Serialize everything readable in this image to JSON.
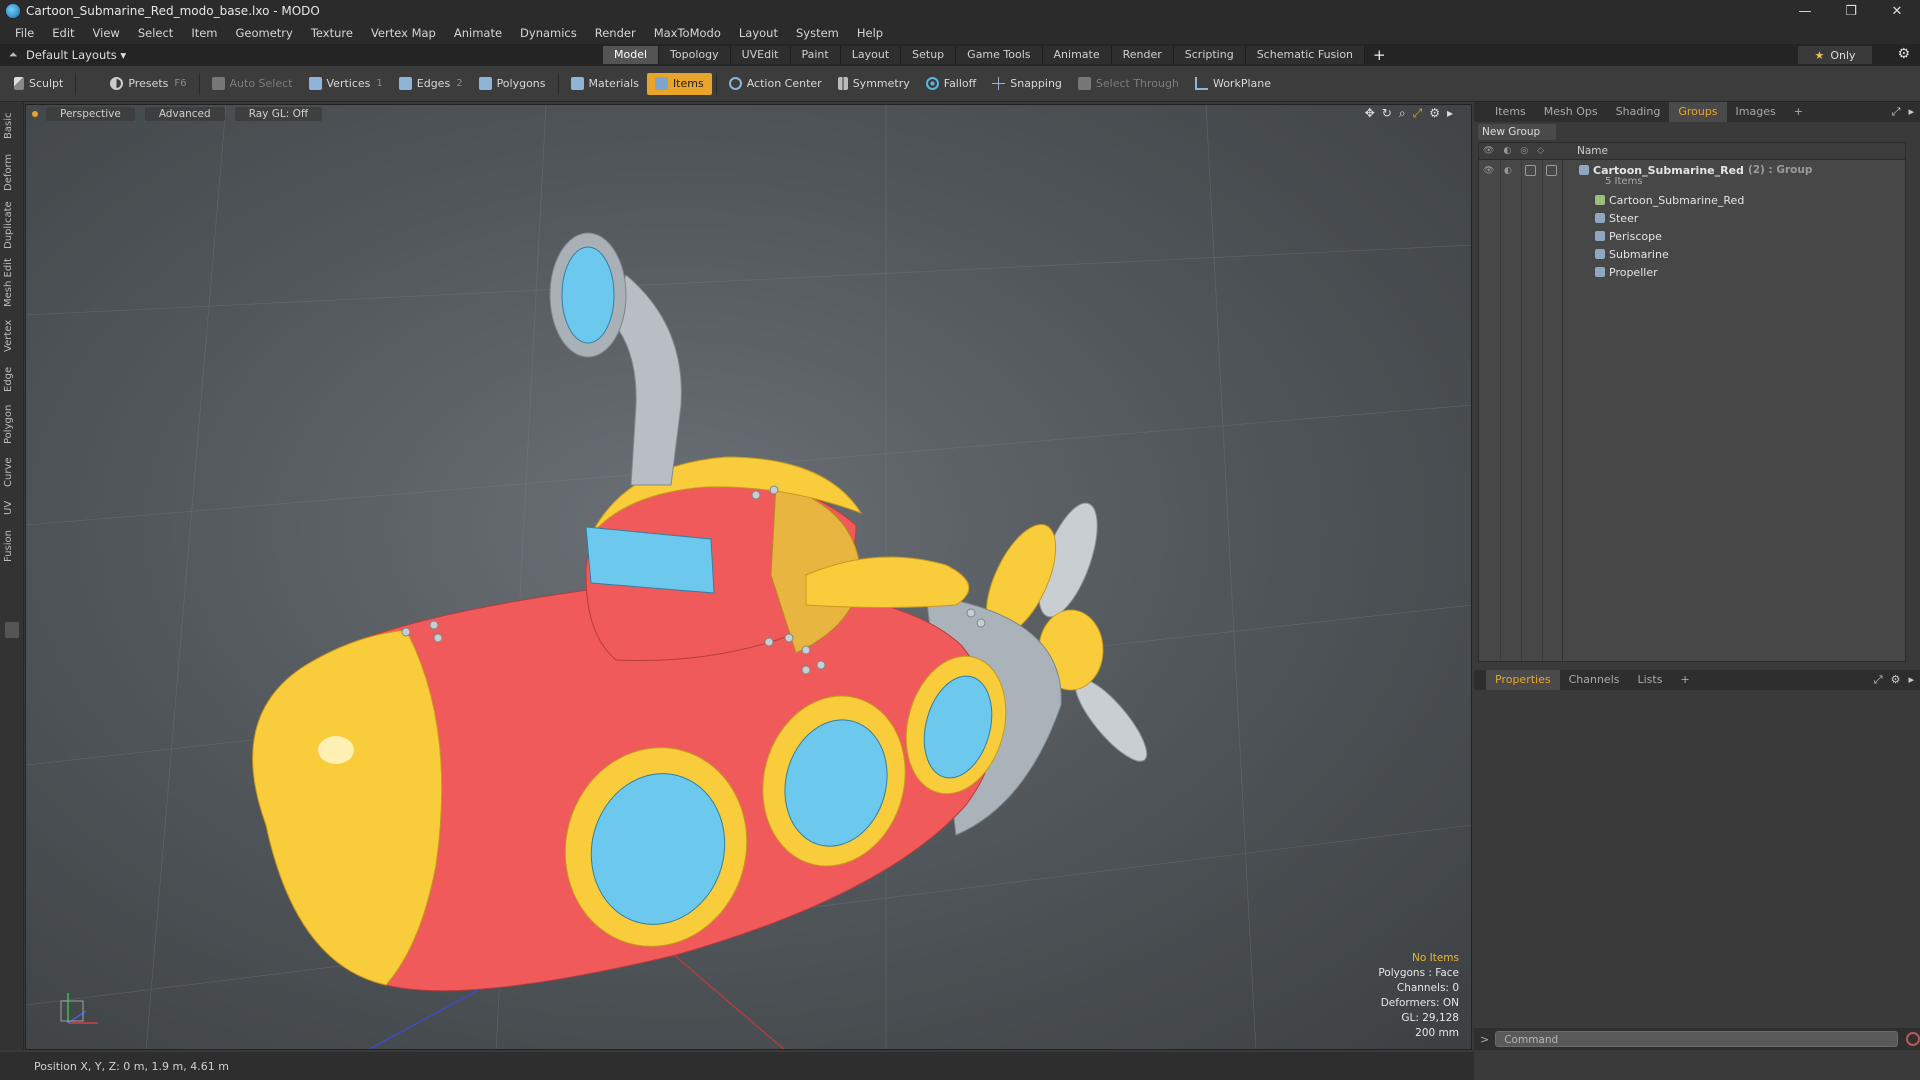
{
  "window": {
    "title": "Cartoon_Submarine_Red_modo_base.lxo - MODO",
    "min_glyph": "—",
    "restore_glyph": "❐",
    "close_glyph": "✕"
  },
  "menu": [
    "File",
    "Edit",
    "View",
    "Select",
    "Item",
    "Geometry",
    "Texture",
    "Vertex Map",
    "Animate",
    "Dynamics",
    "Render",
    "MaxToModo",
    "Layout",
    "System",
    "Help"
  ],
  "layout_bar": {
    "dropdown_label": "Default Layouts ▾",
    "tabs": [
      "Model",
      "Topology",
      "UVEdit",
      "Paint",
      "Layout",
      "Setup",
      "Game Tools",
      "Animate",
      "Render",
      "Scripting",
      "Schematic Fusion"
    ],
    "active_tab": "Model",
    "add_label": "+",
    "only_star": "★",
    "only_label": "Only",
    "gear": "⚙"
  },
  "toolbar": {
    "sculpt": "Sculpt",
    "presets": "Presets",
    "presets_key": "F6",
    "auto_select": "Auto Select",
    "vertices": "Vertices",
    "vertices_key": "1",
    "edges": "Edges",
    "edges_key": "2",
    "polygons": "Polygons",
    "materials": "Materials",
    "items": "Items",
    "action_center": "Action Center",
    "symmetry": "Symmetry",
    "falloff": "Falloff",
    "snapping": "Snapping",
    "select_through": "Select Through",
    "workplane": "WorkPlane"
  },
  "left_tabs": [
    "Basic",
    "Deform",
    "Duplicate",
    "Mesh Edit",
    "Vertex",
    "Edge",
    "Polygon",
    "Curve",
    "UV",
    "Fusion"
  ],
  "viewport": {
    "perspective": "Perspective",
    "advanced": "Advanced",
    "raygl": "Ray GL: Off",
    "info": {
      "no_items": "No Items",
      "polygons": "Polygons : Face",
      "channels": "Channels: 0",
      "deformers": "Deformers: ON",
      "gl": "GL: 29,128",
      "scale": "200 mm"
    },
    "colors": {
      "hull_red": "#f05a5a",
      "hull_yellow": "#f8cc3a",
      "glass": "#6cc8ec",
      "metal": "#aab2b8"
    }
  },
  "right_panel": {
    "tabs": [
      "Items",
      "Mesh Ops",
      "Shading",
      "Groups",
      "Images"
    ],
    "active_tab": "Groups",
    "add_label": "+",
    "new_group": "New Group",
    "name_header": "Name",
    "group": {
      "name": "Cartoon_Submarine_Red",
      "meta": "(2) : Group",
      "count": "5 Items",
      "items": [
        "Cartoon_Submarine_Red",
        "Steer",
        "Periscope",
        "Submarine",
        "Propeller"
      ]
    },
    "bottom_tabs": [
      "Properties",
      "Channels",
      "Lists"
    ],
    "bottom_active": "Properties",
    "command_placeholder": "Command"
  },
  "status": {
    "position": "Position X, Y, Z:  0 m, 1.9 m, 4.61 m"
  }
}
